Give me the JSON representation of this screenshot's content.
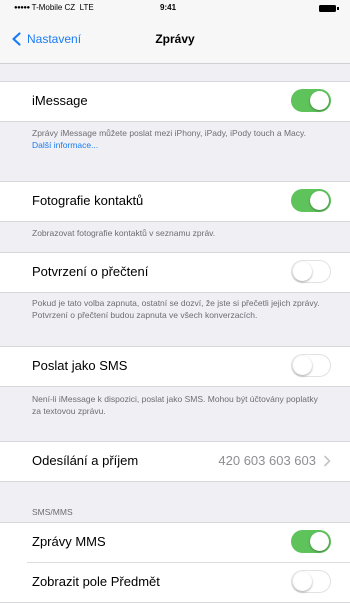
{
  "status_bar": {
    "carrier": "T-Mobile CZ",
    "network": "LTE",
    "time": "9:41"
  },
  "nav": {
    "back_label": "Nastavení",
    "title": "Zprávy"
  },
  "settings": {
    "imessage": {
      "label": "iMessage",
      "on": true
    },
    "imessage_footer": {
      "text": "Zprávy iMessage můžete poslat mezi iPhony, iPady, iPody touch a Macy.",
      "link": "Další informace..."
    },
    "contact_photos": {
      "label": "Fotografie kontaktů",
      "on": true
    },
    "contact_photos_footer": "Zobrazovat fotografie kontaktů v seznamu zpráv.",
    "read_receipts": {
      "label": "Potvrzení o přečtení",
      "on": false
    },
    "read_receipts_footer": "Pokud je tato volba zapnuta, ostatní se dozví, že jste si přečetli jejich zprávy. Potvrzení o přečtení budou zapnuta ve všech konverzacích.",
    "send_as_sms": {
      "label": "Poslat jako SMS",
      "on": false
    },
    "send_as_sms_footer": "Není-li iMessage k dispozici, poslat jako SMS. Mohou být účtovány poplatky za textovou zprávu.",
    "send_receive": {
      "label": "Odesílání a příjem",
      "value": "420 603 603 603"
    },
    "sms_mms_header": "SMS/MMS",
    "mms_messages": {
      "label": "Zprávy MMS",
      "on": true
    },
    "show_subject": {
      "label": "Zobrazit pole Předmět",
      "on": false
    }
  },
  "colors": {
    "accent": "#1a7cf5",
    "toggle_on": "#5fc35c",
    "background": "#efeff4"
  },
  "icons": {
    "back": "chevron-left-icon",
    "disclosure": "chevron-right-icon",
    "battery": "battery-icon"
  }
}
